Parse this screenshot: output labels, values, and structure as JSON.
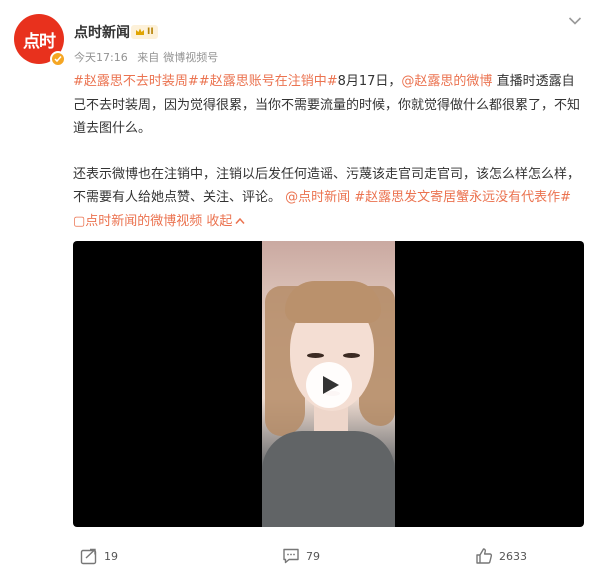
{
  "post": {
    "author": {
      "name": "点时新闻",
      "avatar_text": "点时",
      "level_badge": "II",
      "verified_color": "#f5a623"
    },
    "meta": {
      "time": "今天17:16",
      "source_prefix": "来自",
      "source": "微博视频号"
    },
    "content": {
      "topic1": "#赵露思不去时装周#",
      "topic2": "#赵露思账号在注销中#",
      "date": "8月17日，",
      "mention1": "@赵露思的微博",
      "text1": " 直播时透露自己不去时装周，因为觉得很累，当你不需要流量的时候，你就觉得做什么都很累了，不知道去图什么。",
      "text2": "还表示微博也在注销中，注销以后发任何造谣、污蔑该走官司走官司，该怎么样怎么样，不需要有人给她点赞、关注、评论。 ",
      "mention2": "@点时新闻",
      "topic3": " #赵露思发文寄居蟹永远没有代表作#",
      "video_link": " ▢点时新闻的微博视频",
      "collapse": " 收起",
      "collapse_icon": "chevron-up-icon",
      "link_color": "#eb7350"
    },
    "video": {
      "state": "paused",
      "play_icon": "play-icon"
    },
    "actions": {
      "repost_count": "19",
      "comment_count": "79",
      "like_count": "2633"
    }
  },
  "colors": {
    "brand": "#e8311d",
    "link": "#eb7350",
    "meta": "#939393"
  }
}
